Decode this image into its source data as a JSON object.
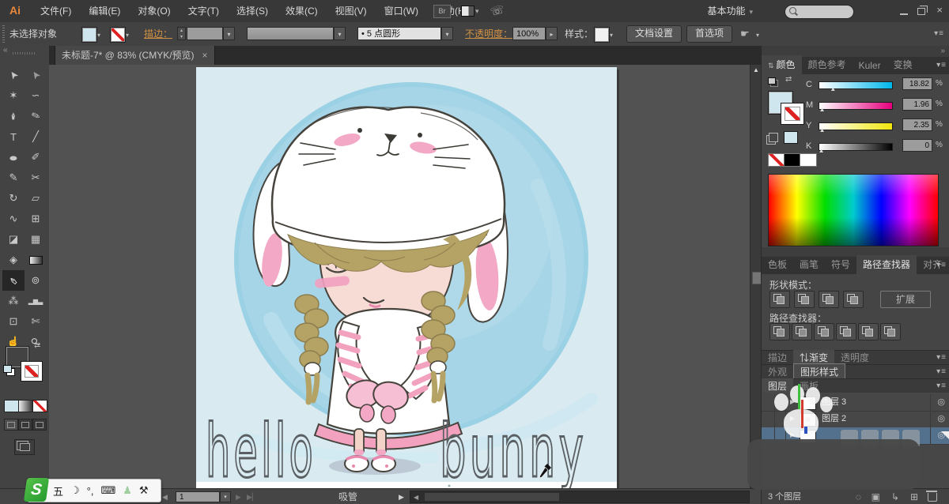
{
  "app": {
    "logo": "Ai",
    "bridge_label": "Br",
    "workspace": "基本功能"
  },
  "menubar": {
    "items": [
      "文件(F)",
      "编辑(E)",
      "对象(O)",
      "文字(T)",
      "选择(S)",
      "效果(C)",
      "视图(V)",
      "窗口(W)",
      "帮助(H)"
    ]
  },
  "controlbar": {
    "no_selection": "未选择对象",
    "stroke_link": "描边：",
    "brush_value": "5 点圆形",
    "opacity_link": "不透明度：",
    "opacity_value": "100%",
    "style_label": "样式：",
    "doc_setup": "文档设置",
    "preferences": "首选项"
  },
  "document": {
    "tab_title": "未标题-7* @ 83% (CMYK/预览)",
    "artwork": {
      "text_left": "hello",
      "text_right": "bunny"
    }
  },
  "colors": {
    "fill": "#cfe6ee",
    "accent_link": "#cf9146",
    "selected_row": "#53708c",
    "artboard_bg": "#d9ebf1",
    "watercolor": "#a6d5e7",
    "pink": "#f3a8c5",
    "hair": "#b5a366"
  },
  "tools": [
    {
      "n": "selection-tool",
      "g": "➤",
      "r": -125
    },
    {
      "n": "direct-selection-tool",
      "g": "➤",
      "r": -125,
      "dim": true
    },
    {
      "n": "magic-wand-tool",
      "g": "✶"
    },
    {
      "n": "lasso-tool",
      "g": "∽"
    },
    {
      "n": "pen-tool",
      "g": "✒",
      "r": -90
    },
    {
      "n": "quill-pen-tool",
      "g": "✎",
      "r": -20
    },
    {
      "n": "type-tool",
      "g": "T"
    },
    {
      "n": "line-segment-tool",
      "g": "╱"
    },
    {
      "n": "ellipse-tool",
      "g": "●",
      "c": "g-wide"
    },
    {
      "n": "paintbrush-tool",
      "g": "✐"
    },
    {
      "n": "pencil-tool",
      "g": "✎"
    },
    {
      "n": "scissors-tool",
      "g": "✂"
    },
    {
      "n": "rotate-tool",
      "g": "↻"
    },
    {
      "n": "scale-tool",
      "g": "▱"
    },
    {
      "n": "width-tool",
      "g": "∿"
    },
    {
      "n": "free-transform-tool",
      "g": "⊞"
    },
    {
      "n": "shape-builder-tool",
      "g": "◪"
    },
    {
      "n": "perspective-grid-tool",
      "g": "▦"
    },
    {
      "n": "mesh-tool",
      "g": "◈"
    },
    {
      "n": "gradient-tool",
      "g": "",
      "c": "g-grad"
    },
    {
      "n": "eyedropper-tool",
      "g": "✑",
      "r": 225,
      "a": true
    },
    {
      "n": "blend-tool",
      "g": "⊚"
    },
    {
      "n": "symbol-sprayer-tool",
      "g": "⁂"
    },
    {
      "n": "column-graph-tool",
      "g": "▂▆▃",
      "c": "g-bars"
    },
    {
      "n": "artboard-tool",
      "g": "⊡"
    },
    {
      "n": "slice-tool",
      "g": "✄"
    },
    {
      "n": "hand-tool",
      "g": "☝"
    },
    {
      "n": "zoom-tool",
      "g": "⚲",
      "r": -45
    }
  ],
  "panels": {
    "color": {
      "tabs": [
        "颜色",
        "颜色参考",
        "Kuler",
        "变换"
      ],
      "active_tab": 0,
      "sliders": [
        {
          "ch": "C",
          "value": "18.82",
          "pct": 20,
          "color": "#00b7eb"
        },
        {
          "ch": "M",
          "value": "1.96",
          "pct": 5,
          "color": "#e5007d"
        },
        {
          "ch": "Y",
          "value": "2.35",
          "pct": 5,
          "color": "#f0e60c"
        },
        {
          "ch": "K",
          "value": "0",
          "pct": 4,
          "color": "#000000"
        }
      ],
      "unit": "%"
    },
    "pathfinder": {
      "tabs": [
        "色板",
        "画笔",
        "符号",
        "路径查找器",
        "对齐"
      ],
      "active_tab": 3,
      "shape_modes_label": "形状模式：",
      "shape_modes": [
        "unite",
        "minus-front",
        "intersect",
        "exclude"
      ],
      "expand_label": "扩展",
      "pathfinder_label": "路径查找器：",
      "pathfinder_buttons": [
        "divide",
        "trim",
        "merge",
        "crop",
        "outline",
        "minus-back"
      ]
    },
    "collapsed_groups": [
      {
        "tabs": [
          "描边",
          "渐变",
          "透明度"
        ],
        "active": 1,
        "caret_on_active": true
      },
      {
        "tabs": [
          "外观",
          "图形样式"
        ],
        "active": 1,
        "boxed_active": true
      },
      {
        "tabs": [
          "图层",
          "画板"
        ],
        "active": 0
      }
    ],
    "layers": {
      "rows": [
        {
          "label": "图层 3",
          "selected": false
        },
        {
          "label": "图层 2",
          "selected": false
        },
        {
          "label": "",
          "selected": true
        }
      ],
      "count_label": "3 个图层"
    }
  },
  "statusbar": {
    "artboard_value": "1",
    "tool_hint": "吸管"
  },
  "ime": {
    "icons": [
      {
        "n": "ime-mode-icon",
        "g": "五"
      },
      {
        "n": "ime-moon-icon",
        "g": "☽"
      },
      {
        "n": "ime-punct-icon",
        "g": "°,"
      },
      {
        "n": "ime-keyboard-icon",
        "g": "⌨"
      },
      {
        "n": "ime-account-icon",
        "g": "♟"
      },
      {
        "n": "ime-toolbox-icon",
        "g": "⚒"
      }
    ]
  },
  "icons": {
    "close": "×",
    "dropdown": "▾",
    "spin_up": "▴",
    "spin_down": "▾",
    "panel_menu": "▾≡",
    "prev": "◀",
    "next": "▶",
    "last": "▶▏",
    "swap": "⇄",
    "collapse_left": "«",
    "collapse_right": "»",
    "target": "◎",
    "expand_row": "▶",
    "caret_pair": "⇅",
    "bullet": "•",
    "clip_mask": "▣",
    "new_sublayer": "↳",
    "new_layer": "⊞",
    "outline_circle": "◌",
    "cs_live": "☏",
    "stamp": "☛",
    "scroll_up": "▲"
  }
}
